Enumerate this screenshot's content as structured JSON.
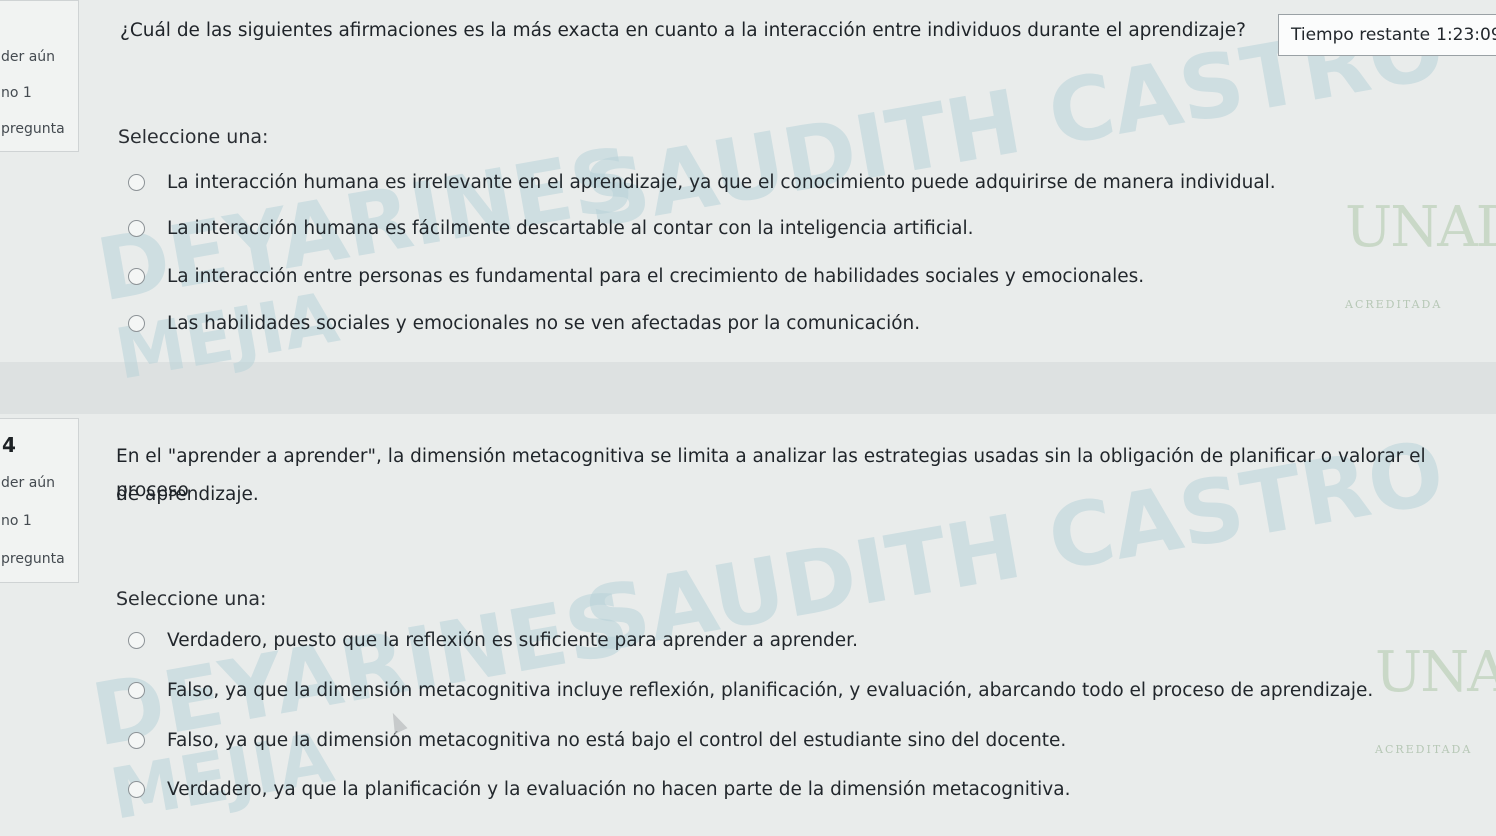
{
  "timer": {
    "label": "Tiempo restante",
    "value": "1:23:09"
  },
  "questions": [
    {
      "number": "",
      "sidebar": [
        "der aún",
        "no 1",
        "pregunta"
      ],
      "text": "¿Cuál de las siguientes afirmaciones es la más exacta en cuanto a la interacción entre individuos durante el aprendizaje?",
      "select_label": "Seleccione una:",
      "options": [
        "La interacción humana es irrelevante en el aprendizaje, ya que el conocimiento puede adquirirse de manera individual.",
        "La interacción humana es fácilmente descartable al contar con la inteligencia artificial.",
        "La interacción entre personas es fundamental para el crecimiento de habilidades sociales y emocionales.",
        "Las habilidades sociales y emocionales no se ven afectadas por la comunicación."
      ]
    },
    {
      "number": "4",
      "sidebar": [
        "der aún",
        "no 1",
        "pregunta"
      ],
      "text_line1": "En el \"aprender a aprender\", la dimensión metacognitiva se limita a analizar las estrategias usadas sin la obligación de planificar o valorar el proceso",
      "text_line2": "de aprendizaje.",
      "select_label": "Seleccione una:",
      "options": [
        "Verdadero, puesto que la reflexión es suficiente para aprender a aprender.",
        "Falso, ya que la dimensión metacognitiva incluye reflexión, planificación, y evaluación, abarcando todo el proceso de aprendizaje.",
        "Falso, ya que la dimensión metacognitiva no está bajo el control del estudiante sino del docente.",
        "Verdadero, ya que la planificación y la evaluación no hacen parte de la dimensión metacognitiva."
      ]
    }
  ],
  "watermark": {
    "line1": "SAUDITH CASTRO",
    "line2": "DEYARINES",
    "line3": "MEJIA"
  },
  "logo": {
    "text": "UNAD",
    "caption": "ACREDITADA"
  }
}
